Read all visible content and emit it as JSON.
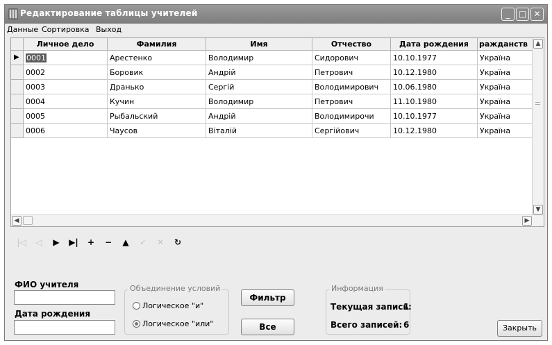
{
  "window": {
    "title": "Редактирование таблицы учителей"
  },
  "menu": [
    "Данные",
    "Сортировка",
    "Выход"
  ],
  "grid": {
    "columns": [
      "Личное дело",
      "Фамилия",
      "Имя",
      "Отчество",
      "Дата рождения",
      "ражданств"
    ],
    "rows": [
      [
        "0001",
        "Арестенко",
        "Володимир",
        "Сидорович",
        "10.10.1977",
        "Україна"
      ],
      [
        "0002",
        "Боровик",
        "Андрій",
        "Петрович",
        "10.12.1980",
        "Україна"
      ],
      [
        "0003",
        "Дранько",
        "Сергій",
        "Володимирович",
        "10.06.1980",
        "Україна"
      ],
      [
        "0004",
        "Кучин",
        "Володимир",
        "Петрович",
        "11.10.1980",
        "Україна"
      ],
      [
        "0005",
        "Рыбальский",
        "Андрій",
        "Володимирочи",
        "10.10.1977",
        "Україна"
      ],
      [
        "0006",
        "Чаусов",
        "Віталій",
        "Сергійович",
        "10.12.1980",
        "Україна"
      ]
    ],
    "selected_row": 0
  },
  "navigator": {
    "buttons": [
      {
        "name": "first-icon",
        "glyph": "|◁",
        "enabled": false
      },
      {
        "name": "prior-icon",
        "glyph": "◁",
        "enabled": false
      },
      {
        "name": "next-icon",
        "glyph": "▶",
        "enabled": true
      },
      {
        "name": "last-icon",
        "glyph": "▶|",
        "enabled": true
      },
      {
        "name": "insert-icon",
        "glyph": "+",
        "enabled": true
      },
      {
        "name": "delete-icon",
        "glyph": "−",
        "enabled": true
      },
      {
        "name": "edit-icon",
        "glyph": "▲",
        "enabled": true
      },
      {
        "name": "post-icon",
        "glyph": "✓",
        "enabled": false
      },
      {
        "name": "cancel-icon",
        "glyph": "✕",
        "enabled": false
      },
      {
        "name": "refresh-icon",
        "glyph": "↻",
        "enabled": true
      }
    ]
  },
  "filter": {
    "fio_label": "ФИО учителя",
    "fio_value": "",
    "birth_label": "Дата рождения",
    "birth_value": "",
    "group_caption": "Объединение условий",
    "option_and": "Логическое \"и\"",
    "option_or": "Логическое \"или\"",
    "selected_option": "or",
    "filter_button": "Фильтр",
    "all_button": "Все"
  },
  "info": {
    "caption": "Информация",
    "current_label": "Текущая запись:",
    "current_value": "1",
    "total_label": "Всего записей:",
    "total_value": "6"
  },
  "close_button": "Закрыть"
}
